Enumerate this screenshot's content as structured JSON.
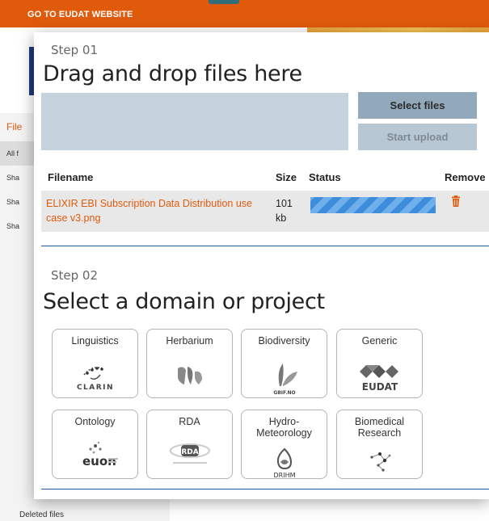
{
  "topbar": {
    "link": "GO TO EUDAT WEBSITE"
  },
  "background": {
    "sidebar_title": "File",
    "sidebar_items": [
      "All f",
      "Sha",
      "Sha",
      "Sha"
    ],
    "deleted_files": "Deleted files"
  },
  "step1": {
    "label": "Step 01",
    "title": "Drag and drop files here",
    "select_button": "Select files",
    "start_button": "Start upload",
    "table": {
      "headers": {
        "filename": "Filename",
        "size": "Size",
        "status": "Status",
        "remove": "Remove"
      },
      "row": {
        "filename": "ELIXIR EBI Subscription Data Distribution use case v3.png",
        "size": "101 kb",
        "progress": 1.0
      }
    }
  },
  "step2": {
    "label": "Step 02",
    "title": "Select a domain or project",
    "domains": [
      {
        "label": "Linguistics",
        "logo_text": "CLARIN"
      },
      {
        "label": "Herbarium",
        "logo_text": ""
      },
      {
        "label": "Biodiversity",
        "logo_text": "GBIF.NO"
      },
      {
        "label": "Generic",
        "logo_text": "EUDAT"
      },
      {
        "label": "Ontology",
        "logo_text": "euon"
      },
      {
        "label": "RDA",
        "logo_text": "RDA"
      },
      {
        "label": "Hydro-\nMeteorology",
        "logo_text": "DRIHM"
      },
      {
        "label": "Biomedical\nResearch",
        "logo_text": ""
      }
    ]
  },
  "colors": {
    "accent": "#e05a0c",
    "button": "#91a9bb",
    "progress": "#3a8ed9"
  }
}
